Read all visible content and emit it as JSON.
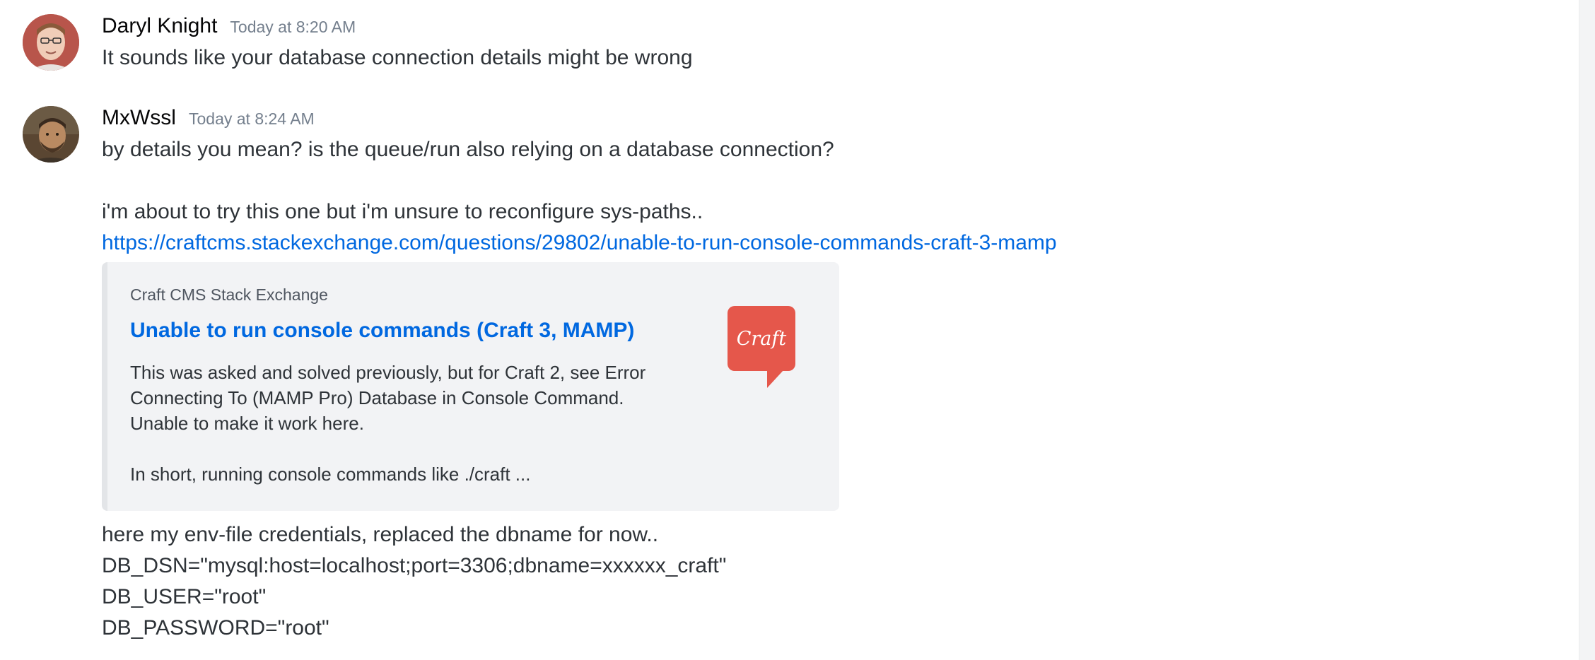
{
  "messages": [
    {
      "username": "Daryl Knight",
      "timestamp": "Today at 8:20 AM",
      "lines": [
        "It sounds like your database connection details might be wrong"
      ]
    },
    {
      "username": "MxWssl",
      "timestamp": "Today at 8:24 AM",
      "lines": [
        "by details you mean? is the queue/run also relying on a database connection?",
        "i'm about to try this one but i'm unsure to reconfigure sys-paths.."
      ],
      "link": "https://craftcms.stackexchange.com/questions/29802/unable-to-run-console-commands-craft-3-mamp",
      "embed": {
        "provider": "Craft CMS Stack Exchange",
        "title": "Unable to run console commands (Craft 3, MAMP)",
        "description_lines": [
          "This was asked and solved previously, but for Craft 2, see Error",
          "Connecting To (MAMP Pro) Database in Console Command.",
          "Unable to make it work here.",
          "",
          "In short, running console commands like ./craft ..."
        ],
        "thumbnail_text": "Craft",
        "thumbnail_icon": "craft-logo-icon",
        "thumbnail_color": "#e5574b"
      },
      "after_lines": [
        "here my env-file credentials, replaced the dbname for now..",
        "DB_DSN=\"mysql:host=localhost;port=3306;dbname=xxxxxx_craft\"",
        "DB_USER=\"root\"",
        "DB_PASSWORD=\"root\""
      ]
    }
  ],
  "colors": {
    "link": "#0068e0",
    "timestamp": "#747f8d",
    "embed_background": "#f2f3f5"
  }
}
